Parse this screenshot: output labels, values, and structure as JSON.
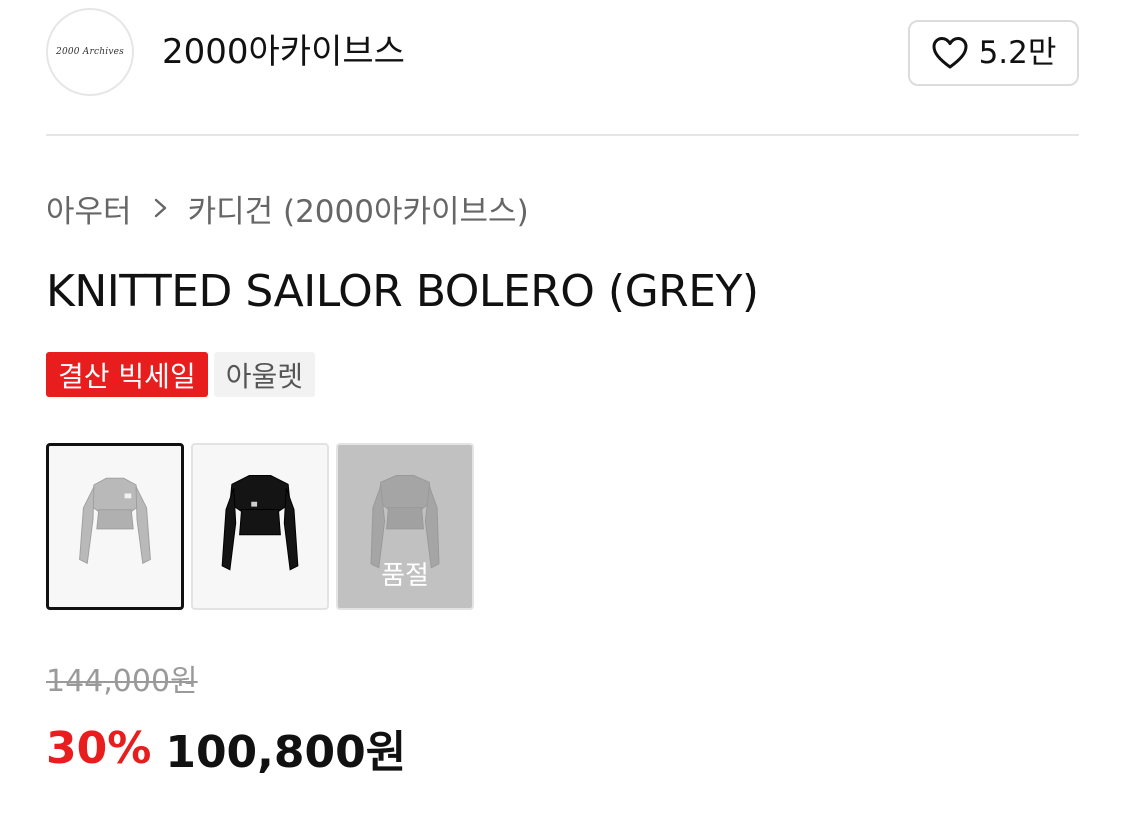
{
  "store": {
    "logo_text": "2000 Archives",
    "name": "2000아카이브스",
    "like_count": "5.2만"
  },
  "breadcrumb": {
    "items": [
      "아우터",
      "카디건 (2000아카이브스)"
    ]
  },
  "product": {
    "title": "KNITTED SAILOR BOLERO (GREY)",
    "badges": [
      {
        "label": "결산 빅세일",
        "color": "#e81d1d"
      },
      {
        "label": "아울렛",
        "color": "#f2f2f2"
      }
    ],
    "options": [
      {
        "color_name": "grey",
        "garment_color": "#b9b9b9",
        "selected": true,
        "sold_out": false
      },
      {
        "color_name": "black",
        "garment_color": "#141414",
        "selected": false,
        "sold_out": false
      },
      {
        "color_name": "grey",
        "garment_color": "#b9b9b9",
        "selected": false,
        "sold_out": true,
        "sold_out_label": "품절"
      }
    ]
  },
  "price": {
    "original": "144,000원",
    "discount": "30%",
    "final": "100,800원"
  },
  "colors": {
    "accent_red": "#e81d1d",
    "text": "#111111",
    "muted": "#666666"
  },
  "icons": {
    "like": "heart-icon",
    "breadcrumb_separator": "chevron-right-icon"
  }
}
